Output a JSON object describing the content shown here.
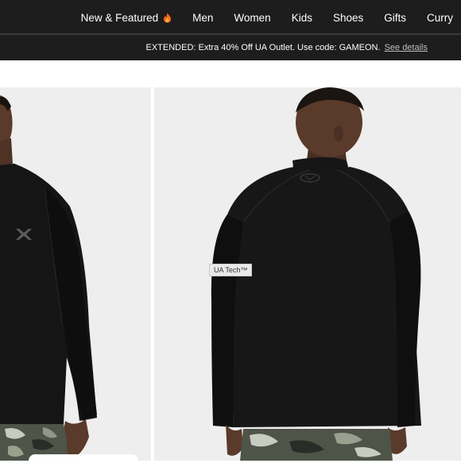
{
  "nav": {
    "items": [
      {
        "label": "New & Featured",
        "icon": "flame-icon"
      },
      {
        "label": "Men"
      },
      {
        "label": "Women"
      },
      {
        "label": "Kids"
      },
      {
        "label": "Shoes"
      },
      {
        "label": "Gifts"
      },
      {
        "label": "Curry"
      }
    ]
  },
  "promo": {
    "text": "EXTENDED: Extra 40% Off UA Outlet. Use code: GAMEON.",
    "link_label": "See details"
  },
  "gallery": {
    "tag_label": "UA Tech™"
  },
  "colors": {
    "nav_bg": "#1d1d1d",
    "gallery_bg": "#eeeeee",
    "shirt": "#111111",
    "flame": "#f26a1b"
  }
}
